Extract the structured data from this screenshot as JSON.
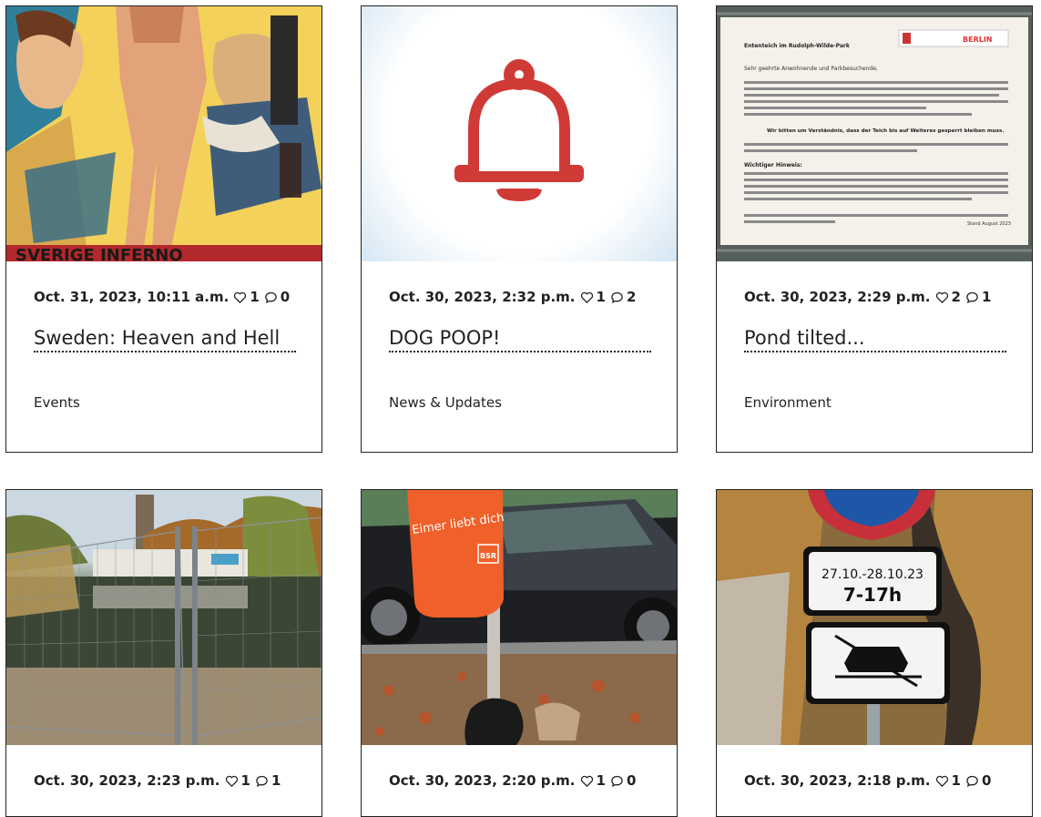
{
  "cards": [
    {
      "date": "Oct. 31, 2023, 10:11 a.m.",
      "likes": "1",
      "comments": "0",
      "title": "Sweden: Heaven and Hell",
      "category": "Events",
      "image": "movie-poster"
    },
    {
      "date": "Oct. 30, 2023, 2:32 p.m.",
      "likes": "1",
      "comments": "2",
      "title": "DOG POOP!",
      "category": "News & Updates",
      "image": "bell-icon"
    },
    {
      "date": "Oct. 30, 2023, 2:29 p.m.",
      "likes": "2",
      "comments": "1",
      "title": "Pond tilted...",
      "category": "Environment",
      "image": "notice-photo"
    },
    {
      "date": "Oct. 30, 2023, 2:23 p.m.",
      "likes": "1",
      "comments": "1",
      "title": "",
      "category": "",
      "image": "pond-photo"
    },
    {
      "date": "Oct. 30, 2023, 2:20 p.m.",
      "likes": "1",
      "comments": "0",
      "title": "",
      "category": "",
      "image": "street-photo"
    },
    {
      "date": "Oct. 30, 2023, 2:18 p.m.",
      "likes": "1",
      "comments": "0",
      "title": "",
      "category": "",
      "image": "sign-photo"
    }
  ],
  "images": {
    "poster_text": "SVERIGE INFERNO",
    "notice": {
      "title": "Ententeich im Rudolph-Wilde-Park",
      "badge": "BERLIN",
      "greeting": "Sehr geehrte Anwohnende und Parkbesuchende,",
      "highlight": "Wir bitten um Verständnis, dass der Teich bis auf Weiteres gesperrt bleiben muss.",
      "note_title": "Wichtiger Hinweis:",
      "footer": "Stand August 2023"
    },
    "bag_text": "Eimer liebt dich",
    "bag_logo": "BSR",
    "sign": {
      "dates": "27.10.-28.10.23",
      "hours": "7-17h"
    }
  },
  "colors": {
    "bell": "#d03a36",
    "bag": "#f0602a"
  }
}
